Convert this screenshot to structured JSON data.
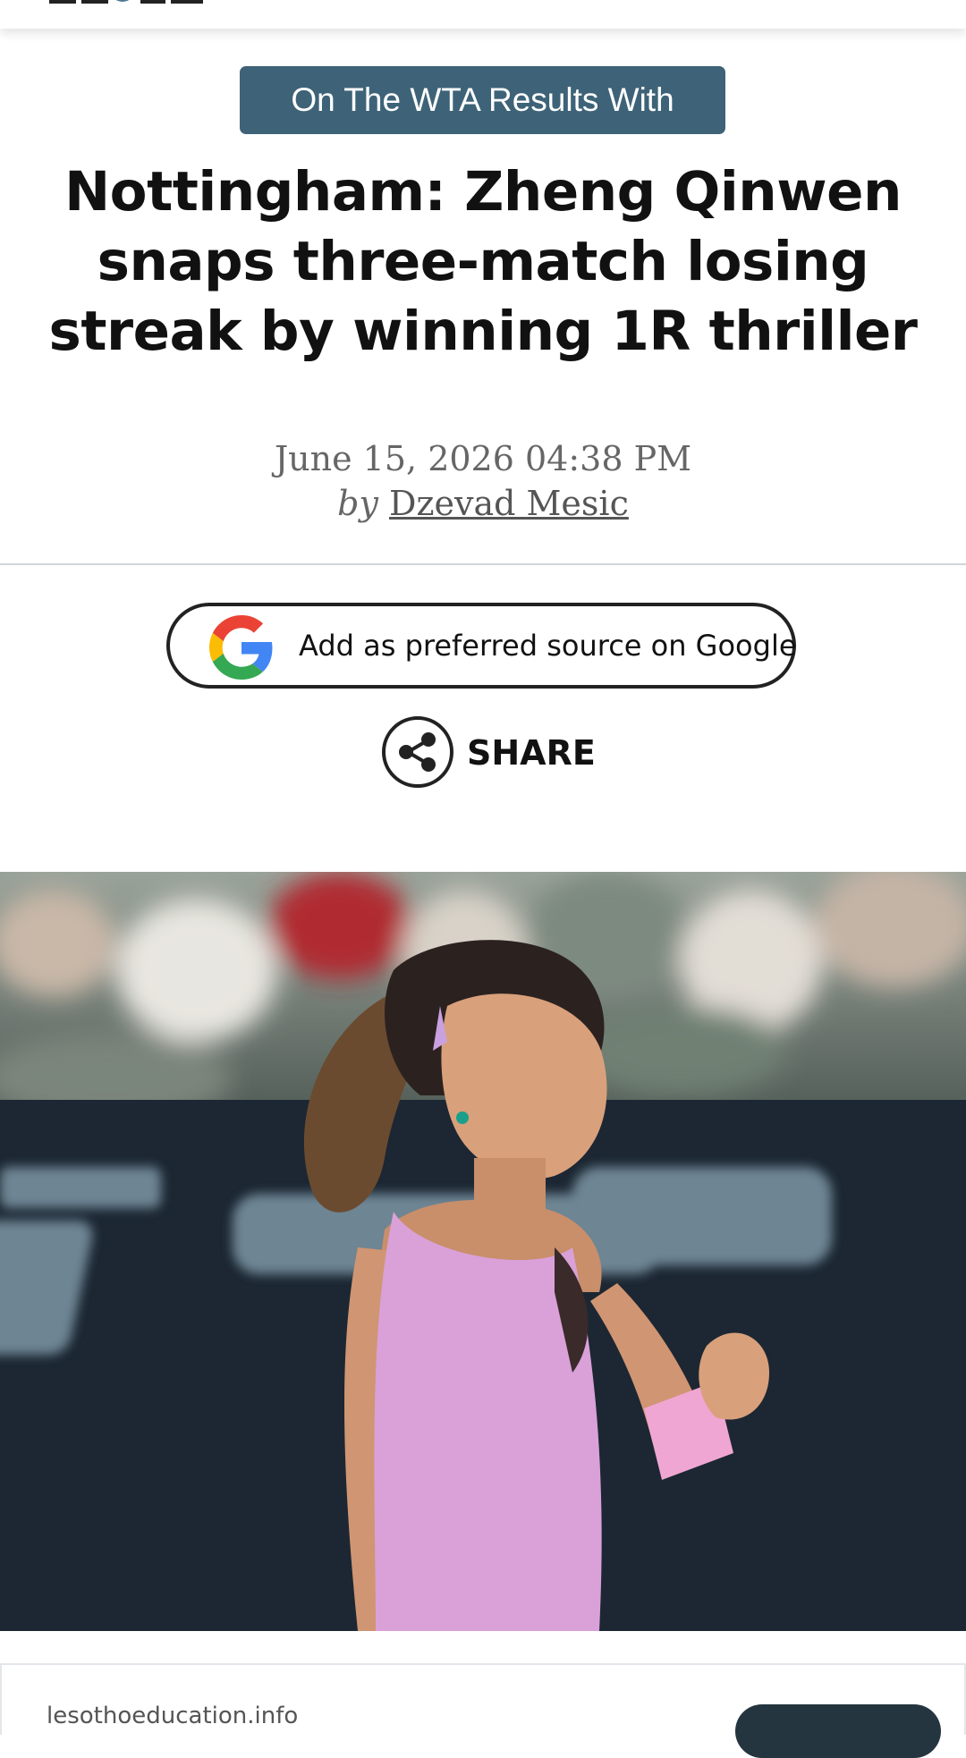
{
  "category": {
    "label": "On The WTA Results With"
  },
  "article": {
    "headline": "Nottingham: Zheng Qinwen snaps three-match losing streak by winning 1R thriller",
    "date": "June 15, 2026 04:38 PM",
    "by_prefix": "by",
    "author": "Dzevad Mesic"
  },
  "google_source": {
    "label": "Add as preferred source on Google",
    "icon": "google-g-icon"
  },
  "share": {
    "label": "SHARE",
    "icon": "share-icon"
  },
  "hero_image": {
    "icon": "player-photo"
  },
  "ad": {
    "domain": "lesothoeducation.info"
  },
  "colors": {
    "badge_bg": "#3e6378",
    "divider": "#cfd6dc",
    "google_blue": "#4285F4",
    "google_red": "#EA4335",
    "google_yellow": "#FBBC05",
    "google_green": "#34A853"
  }
}
